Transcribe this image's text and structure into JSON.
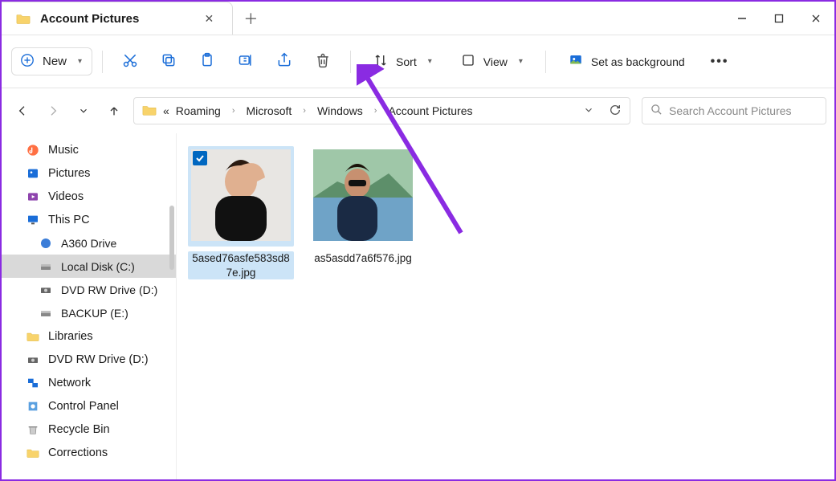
{
  "window": {
    "title": "Account Pictures"
  },
  "toolbar": {
    "new": "New",
    "sort": "Sort",
    "view": "View",
    "background": "Set as background"
  },
  "breadcrumbs": [
    "Roaming",
    "Microsoft",
    "Windows",
    "Account Pictures"
  ],
  "search": {
    "placeholder": "Search Account Pictures"
  },
  "sidebar": [
    {
      "label": "Music",
      "icon": "music",
      "indent": false
    },
    {
      "label": "Pictures",
      "icon": "pictures",
      "indent": false
    },
    {
      "label": "Videos",
      "icon": "videos",
      "indent": false
    },
    {
      "label": "This PC",
      "icon": "pc",
      "indent": false
    },
    {
      "label": "A360 Drive",
      "icon": "a360",
      "indent": true
    },
    {
      "label": "Local Disk (C:)",
      "icon": "disk",
      "indent": true,
      "active": true
    },
    {
      "label": "DVD RW Drive (D:)",
      "icon": "dvd",
      "indent": true
    },
    {
      "label": "BACKUP (E:)",
      "icon": "disk",
      "indent": true
    },
    {
      "label": "Libraries",
      "icon": "folder",
      "indent": false
    },
    {
      "label": "DVD RW Drive (D:)",
      "icon": "dvd",
      "indent": false
    },
    {
      "label": "Network",
      "icon": "network",
      "indent": false
    },
    {
      "label": "Control Panel",
      "icon": "control",
      "indent": false
    },
    {
      "label": "Recycle Bin",
      "icon": "recycle",
      "indent": false
    },
    {
      "label": "Corrections",
      "icon": "folder",
      "indent": false
    }
  ],
  "files": [
    {
      "name": "5ased76asfe583sd87e.jpg",
      "selected": true
    },
    {
      "name": "as5asdd7a6f576.jpg",
      "selected": false
    }
  ],
  "colors": {
    "accent": "#0067c0",
    "annotation": "#8a2be2"
  }
}
